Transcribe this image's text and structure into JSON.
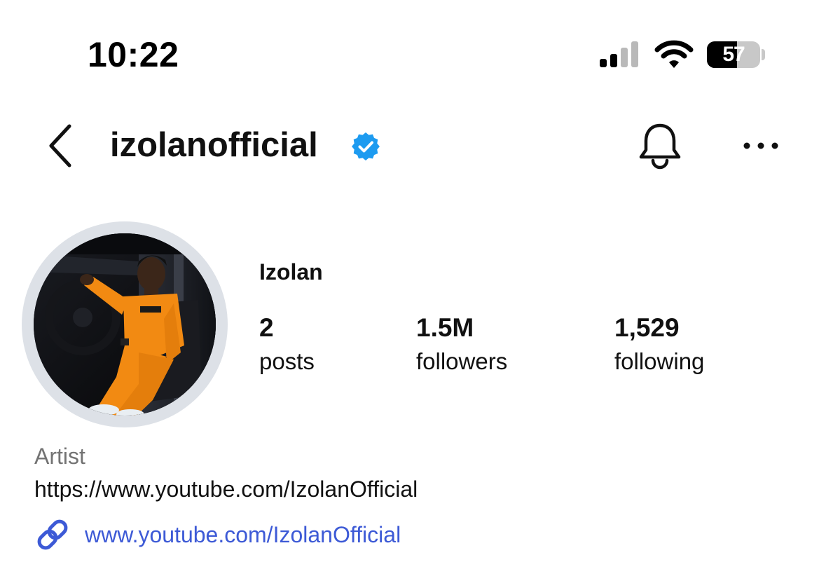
{
  "status_bar": {
    "time": "10:22",
    "battery_level": "57",
    "battery_fraction": 0.57,
    "signal_icon": "cellular-signal-icon",
    "wifi_icon": "wifi-icon"
  },
  "header": {
    "back_icon": "chevron-left-icon",
    "username": "izolanofficial",
    "verified_icon": "verified-badge-icon",
    "notifications_icon": "bell-icon",
    "more_icon": "more-horizontal-icon"
  },
  "profile": {
    "display_name": "Izolan",
    "stats": {
      "posts": {
        "value": "2",
        "label": "posts"
      },
      "followers": {
        "value": "1.5M",
        "label": "followers"
      },
      "following": {
        "value": "1,529",
        "label": "following"
      }
    }
  },
  "bio": {
    "category": "Artist",
    "text": "https://www.youtube.com/IzolanOfficial",
    "link_icon": "link-icon",
    "link": "www.youtube.com/IzolanOfficial"
  },
  "colors": {
    "text": "#111111",
    "secondary_text": "#737373",
    "link": "#3d5ad6",
    "verified": "#1d9bf0",
    "avatar_ring": "#dde1e7",
    "outfit_orange": "#f28a12"
  }
}
